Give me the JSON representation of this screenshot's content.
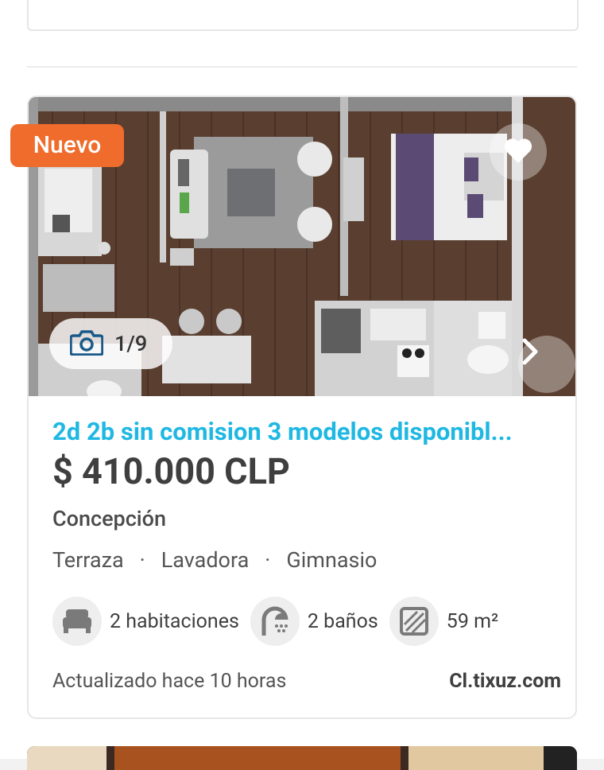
{
  "listing": {
    "badge": "Nuevo",
    "photo_counter": "1/9",
    "title": "2d 2b sin comision 3 modelos disponibl...",
    "price": "$ 410.000 CLP",
    "location": "Concepción",
    "amenities": [
      "Terraza",
      "Lavadora",
      "Gimnasio"
    ],
    "amenity_separator": "·",
    "features": {
      "bedrooms": "2 habitaciones",
      "bathrooms": "2 baños",
      "area": "59 m²"
    },
    "updated": "Actualizado hace 10 horas",
    "source": "Cl.tixuz.com"
  },
  "icons": {
    "favorite": "heart-icon",
    "next": "chevron-right-icon",
    "photos": "camera-icon",
    "bedrooms": "bed-icon",
    "bathrooms": "shower-icon",
    "area": "area-icon"
  },
  "colors": {
    "badge": "#ef6c2c",
    "title": "#1fb8e3",
    "text": "#3f3f3f"
  }
}
